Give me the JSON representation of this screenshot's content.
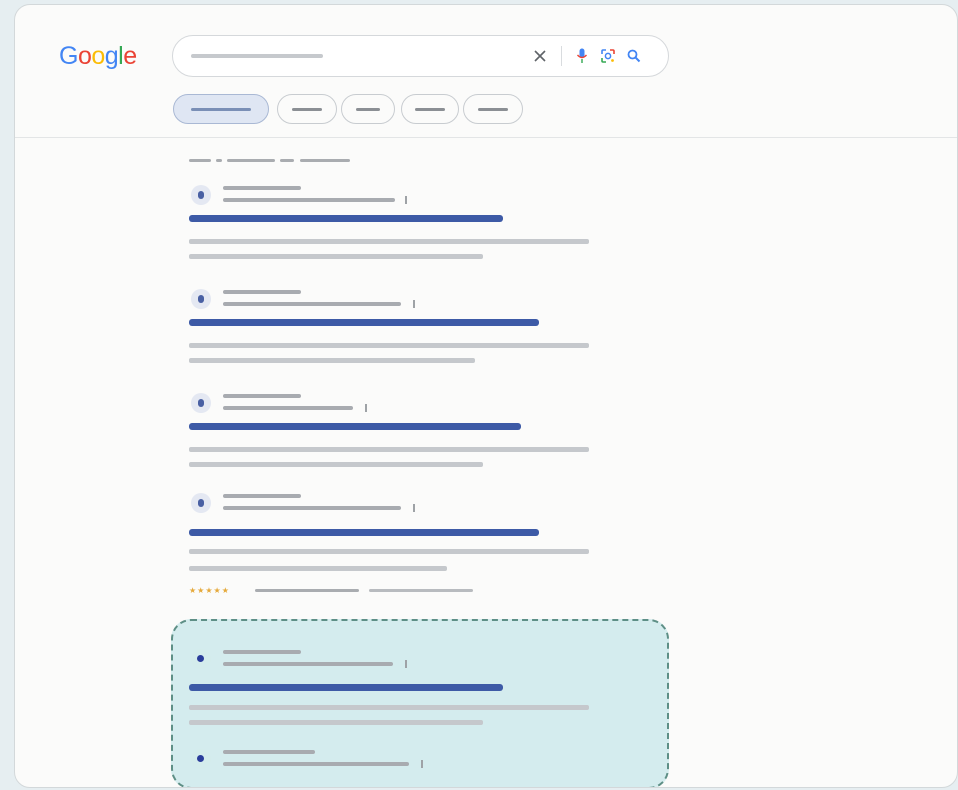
{
  "header": {
    "logo": "Google",
    "logo_colors": [
      "#4285F4",
      "#EA4335",
      "#FBBC05",
      "#4285F4",
      "#34A853",
      "#EA4335"
    ],
    "search": {
      "value": "",
      "placeholder": ""
    },
    "icons": [
      "close-icon",
      "mic-icon",
      "lens-icon",
      "search-icon"
    ],
    "chips": [
      {
        "label": "",
        "active": true
      },
      {
        "label": "",
        "active": false
      },
      {
        "label": "",
        "active": false
      },
      {
        "label": "",
        "active": false
      },
      {
        "label": "",
        "active": false
      }
    ]
  },
  "results": {
    "stats": "",
    "count": 6,
    "has_rating_row": [
      false,
      false,
      false,
      true,
      false,
      false
    ]
  },
  "highlight": {
    "label": "",
    "color": "#8cd2d6",
    "border_color": "#5e8f86"
  },
  "colors": {
    "link": "#3d5aa6",
    "snippet": "#c5c8cc",
    "stars": "#e5a93a"
  }
}
